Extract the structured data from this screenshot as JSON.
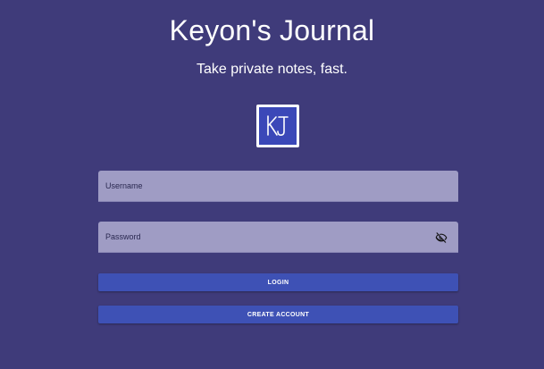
{
  "header": {
    "title": "Keyon's Journal",
    "subtitle": "Take private notes, fast."
  },
  "logo": {
    "text": "KJ",
    "icon": "kj-logo-icon",
    "background": "#3b48b8",
    "border": "#ffffff"
  },
  "form": {
    "username": {
      "placeholder": "Username",
      "value": ""
    },
    "password": {
      "placeholder": "Password",
      "value": "",
      "toggle_icon": "eye-off-icon"
    },
    "login_label": "LOGIN",
    "create_account_label": "CREATE ACCOUNT"
  },
  "colors": {
    "background": "#3f3b7a",
    "field": "#9f9cc4",
    "button": "#3e51b5",
    "text": "#ffffff"
  }
}
